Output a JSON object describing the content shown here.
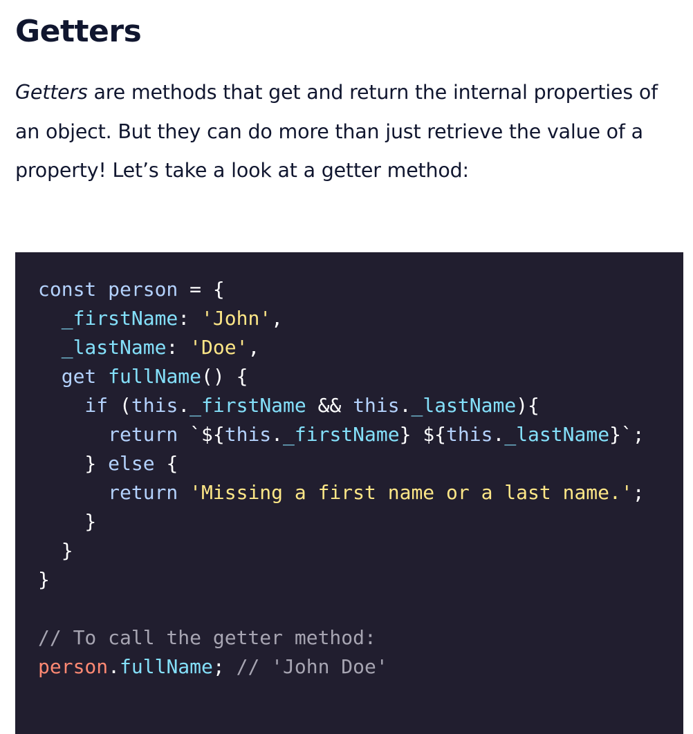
{
  "heading": "Getters",
  "paragraph": {
    "term": "Getters",
    "rest": " are methods that get and return the internal properties of an object. But they can do more than just retrieve the value of a property! Let’s take a look at a getter method:"
  },
  "code": {
    "l1": [
      "const person",
      " = {"
    ],
    "l2": [
      "  _firstName",
      ": ",
      "'John'",
      ","
    ],
    "l3": [
      "  _lastName",
      ": ",
      "'Doe'",
      ","
    ],
    "l4": [
      "  get ",
      "fullName",
      "() {"
    ],
    "l5": [
      "    if ",
      "(",
      "this",
      ".",
      "_firstName",
      " && ",
      "this",
      ".",
      "_lastName",
      "){"
    ],
    "l6": [
      "      return ",
      "`${",
      "this",
      ".",
      "_firstName",
      "} ${",
      "this",
      ".",
      "_lastName",
      "}`",
      ";"
    ],
    "l7": [
      "    } ",
      "else",
      " {"
    ],
    "l8": [
      "      return ",
      "'Missing a first name or a last name.'",
      ";"
    ],
    "l9": "    }",
    "l10": "  }",
    "l11": "}",
    "l13": "// To call the getter method:",
    "l14": [
      "person",
      ".",
      "fullName",
      "; ",
      "// 'John Doe'"
    ]
  },
  "colors": {
    "code_background": "#211e2f",
    "keyword": "#b4d2fd",
    "property": "#84e0fa",
    "string": "#fee787",
    "object": "#ff8973",
    "comment": "#a7a5b2",
    "text": "#10162f"
  }
}
